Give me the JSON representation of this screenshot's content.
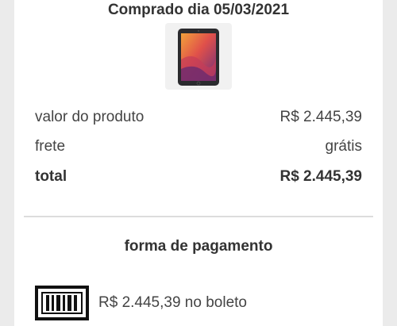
{
  "purchase": {
    "title": "Comprado dia 05/03/2021",
    "product_image_icon": "tablet-product-image"
  },
  "summary": {
    "rows": [
      {
        "label": "valor do produto",
        "value": "R$ 2.445,39"
      },
      {
        "label": "frete",
        "value": "grátis"
      },
      {
        "label": "total",
        "value": "R$ 2.445,39"
      }
    ]
  },
  "payment": {
    "title": "forma de pagamento",
    "method_icon": "barcode-boleto-icon",
    "description": "R$ 2.445,39 no boleto"
  },
  "colors": {
    "background": "#ebebeb",
    "card": "#ffffff",
    "text": "#333333",
    "divider": "#dcdcdc"
  }
}
